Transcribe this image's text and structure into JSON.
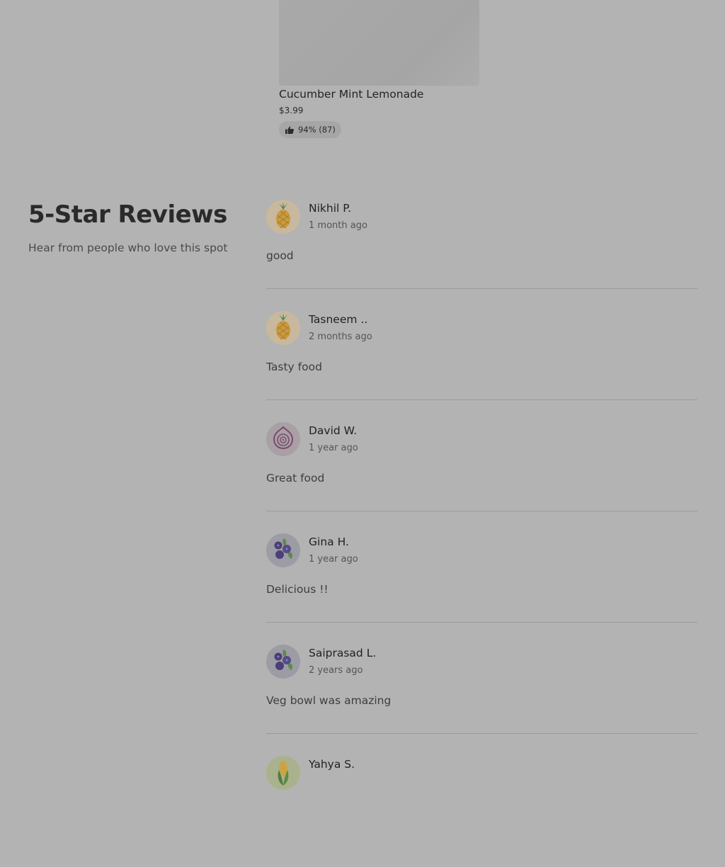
{
  "product": {
    "name": "Cucumber Mint Lemonade",
    "price": "$3.99",
    "rating": "94% (87)"
  },
  "reviews_section": {
    "title": "5-Star Reviews",
    "subtitle": "Hear from people who love this spot",
    "items": [
      {
        "name": "Nikhil P.",
        "date": "1 month ago",
        "text": "good",
        "avatar": "pineapple-icon"
      },
      {
        "name": "Tasneem ..",
        "date": "2 months ago",
        "text": "Tasty food",
        "avatar": "pineapple-icon"
      },
      {
        "name": "David W.",
        "date": "1 year ago",
        "text": "Great food",
        "avatar": "onion-icon"
      },
      {
        "name": "Gina H.",
        "date": "1 year ago",
        "text": "Delicious !!",
        "avatar": "blueberries-icon"
      },
      {
        "name": "Saiprasad L.",
        "date": "2 years ago",
        "text": "Veg bowl was amazing",
        "avatar": "blueberries-icon"
      },
      {
        "name": "Yahya S.",
        "avatar": "corn-icon"
      }
    ]
  }
}
